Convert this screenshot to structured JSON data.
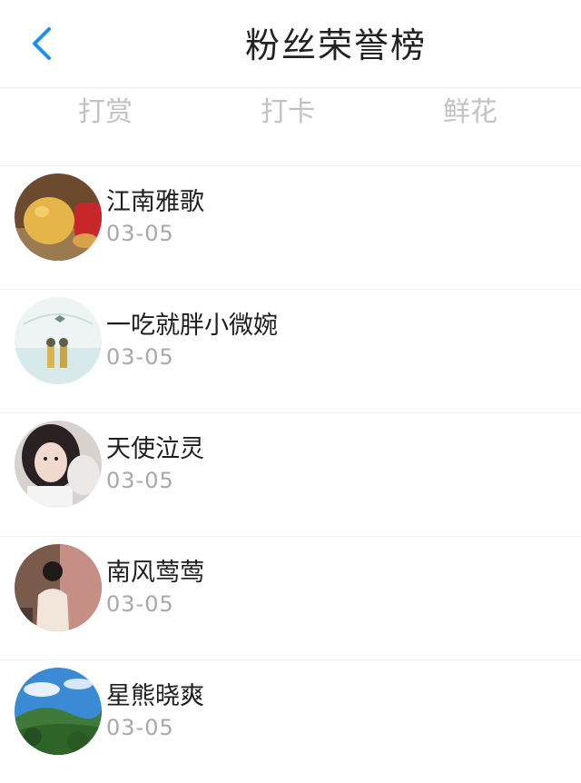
{
  "header": {
    "title": "粉丝荣誉榜",
    "back_icon": "chevron-left-icon",
    "accent_color": "#1e8ef0"
  },
  "tabs": [
    {
      "label": "打赏"
    },
    {
      "label": "打卡"
    },
    {
      "label": "鲜花"
    }
  ],
  "fans": [
    {
      "name": "江南雅歌",
      "date": "03-05"
    },
    {
      "name": "一吃就胖小微婉",
      "date": "03-05"
    },
    {
      "name": "天使泣灵",
      "date": "03-05"
    },
    {
      "name": "南风莺莺",
      "date": "03-05"
    },
    {
      "name": "星熊晓爽",
      "date": "03-05"
    }
  ]
}
